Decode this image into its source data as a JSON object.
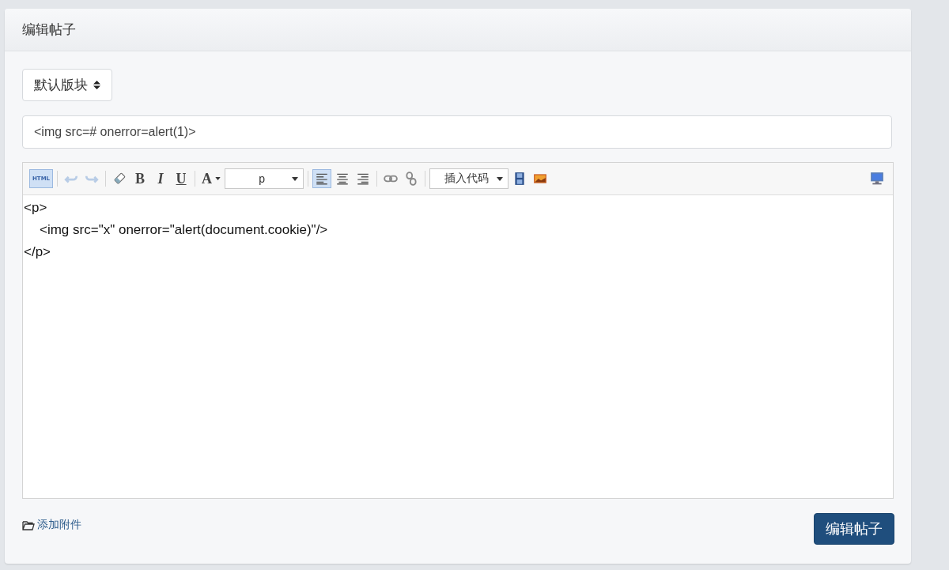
{
  "panel": {
    "title": "编辑帖子"
  },
  "board_select": {
    "value": "默认版块"
  },
  "title_field": {
    "value": "<img src=# onerror=alert(1)>"
  },
  "toolbar": [
    {
      "kind": "html",
      "label": "HTML",
      "selected": true,
      "disabled": false
    },
    {
      "kind": "separator"
    },
    {
      "kind": "undo",
      "selected": false,
      "disabled": true
    },
    {
      "kind": "redo",
      "selected": false,
      "disabled": true
    },
    {
      "kind": "separator"
    },
    {
      "kind": "eraser",
      "selected": false,
      "disabled": false
    },
    {
      "kind": "bold",
      "label": "B",
      "selected": false,
      "disabled": false
    },
    {
      "kind": "italic",
      "label": "I",
      "selected": false,
      "disabled": false
    },
    {
      "kind": "underline",
      "label": "U",
      "selected": false,
      "disabled": false
    },
    {
      "kind": "separator"
    },
    {
      "kind": "fontcolor",
      "label": "A",
      "selected": false,
      "disabled": false
    },
    {
      "kind": "select",
      "value": "p"
    },
    {
      "kind": "separator"
    },
    {
      "kind": "align-left",
      "selected": true,
      "disabled": false
    },
    {
      "kind": "align-center",
      "selected": false,
      "disabled": false
    },
    {
      "kind": "align-right",
      "selected": false,
      "disabled": false
    },
    {
      "kind": "separator"
    },
    {
      "kind": "link",
      "selected": false,
      "disabled": false
    },
    {
      "kind": "unlink",
      "selected": false,
      "disabled": false
    },
    {
      "kind": "separator"
    },
    {
      "kind": "select",
      "value": "插入代码"
    },
    {
      "kind": "video",
      "selected": false,
      "disabled": false
    },
    {
      "kind": "image",
      "selected": false,
      "disabled": false
    },
    {
      "kind": "spacer"
    },
    {
      "kind": "preview",
      "selected": false,
      "disabled": false
    }
  ],
  "editor": {
    "content": [
      {
        "open": "<p>",
        "children": [
          "<img src=\"x\" onerror=\"alert(document.cookie)\"/>"
        ],
        "close": "</p>"
      }
    ]
  },
  "attachment_link": {
    "label": "添加附件"
  },
  "submit_button": {
    "label": "编辑帖子"
  }
}
